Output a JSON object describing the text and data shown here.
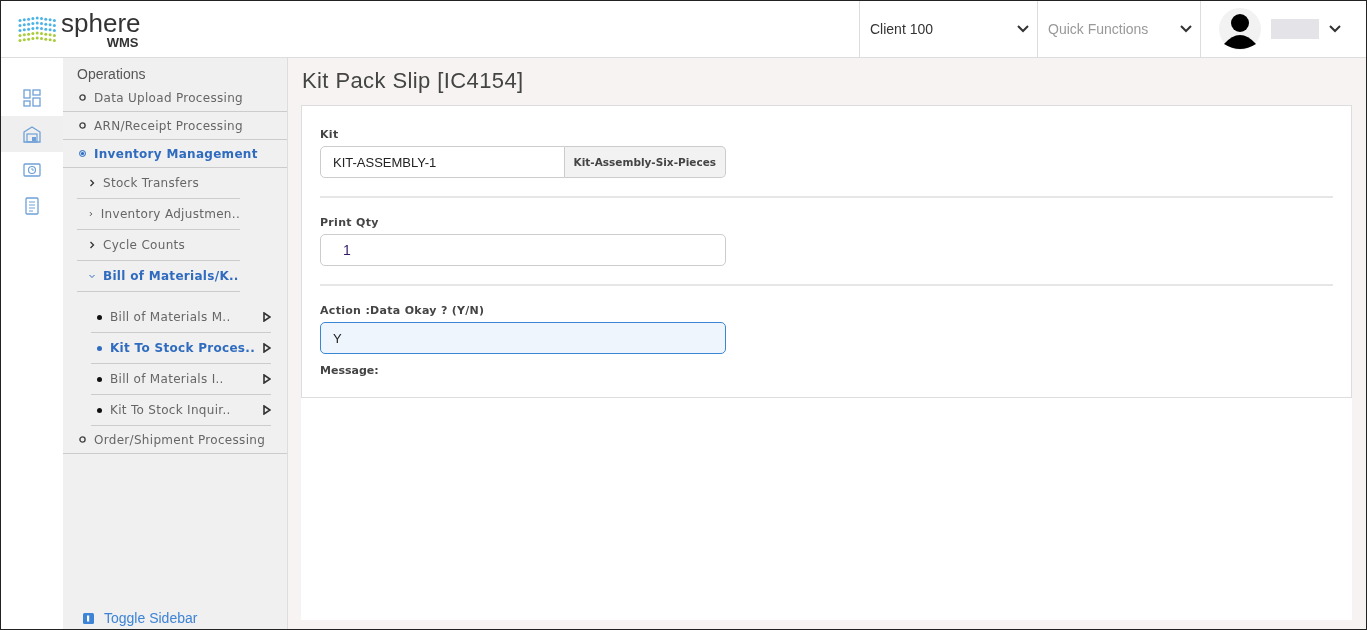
{
  "header": {
    "logo": {
      "name": "sphere",
      "sub": "WMS"
    },
    "client_select": {
      "value": "Client 100"
    },
    "quick_functions": {
      "placeholder": "Quick Functions"
    }
  },
  "rail": [
    {
      "selected": false
    },
    {
      "selected": true
    },
    {
      "selected": false
    },
    {
      "selected": false
    }
  ],
  "sidebar": {
    "title": "Operations",
    "items": [
      {
        "label": "Data Upload Processing",
        "selected": false
      },
      {
        "label": "ARN/Receipt Processing",
        "selected": false
      },
      {
        "label": "Inventory Management",
        "selected": true,
        "children": [
          {
            "label": "Stock Transfers",
            "expanded": false
          },
          {
            "label": "Inventory Adjustmen..",
            "expanded": false
          },
          {
            "label": "Cycle Counts",
            "expanded": false
          },
          {
            "label": "Bill of Materials/K..",
            "expanded": true,
            "children": [
              {
                "label": "Bill of Materials M..",
                "selected": false
              },
              {
                "label": "Kit To Stock Proces..",
                "selected": true
              },
              {
                "label": "Bill of Materials I..",
                "selected": false
              },
              {
                "label": "Kit To Stock Inquir..",
                "selected": false
              }
            ]
          }
        ]
      },
      {
        "label": "Order/Shipment Processing",
        "selected": false
      }
    ],
    "toggle": "Toggle Sidebar"
  },
  "page": {
    "title": "Kit Pack Slip [IC4154]",
    "fields": [
      {
        "label": "Kit",
        "value": "KIT-ASSEMBLY-1",
        "addon": "Kit-Assembly-Six-Pieces",
        "focused": false
      },
      {
        "label": "Print Qty",
        "value": "1",
        "focused": false
      },
      {
        "label": "Action :Data Okay ? (Y/N)",
        "value": "Y",
        "focused": true
      }
    ],
    "message_label": "Message:"
  }
}
